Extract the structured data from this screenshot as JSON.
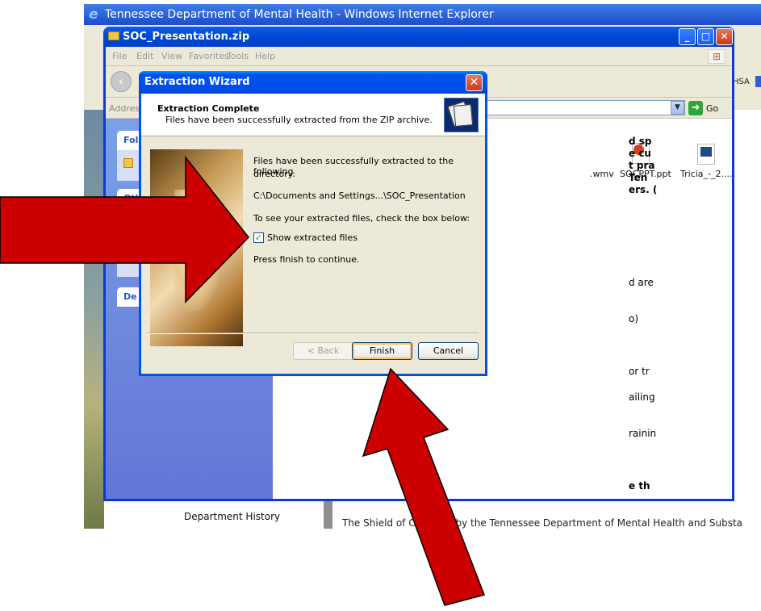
{
  "ie_window": {
    "title": "Tennessee Department of Mental Health - Windows Internet Explorer",
    "hsa_text": "HSA",
    "department_history_link": "Department History",
    "shield_text": "The Shield of Ca          ghted by the Tennessee Department of Mental Health and Substa"
  },
  "zip_window": {
    "title": "SOC_Presentation.zip",
    "menu": [
      "File",
      "Edit",
      "View",
      "Favorites",
      "Tools",
      "Help"
    ],
    "address_label": "Address",
    "go_label": "Go",
    "tasks": {
      "folder_head": "Fol",
      "other_head": "Oth",
      "details_head": "De"
    },
    "files": [
      {
        "name": ".wmv",
        "icon": "video-file-icon"
      },
      {
        "name": "SOCPPT.ppt",
        "icon": "powerpoint-file-icon"
      },
      {
        "name": "Tricia_-_2....",
        "icon": "wmv-file-icon"
      }
    ],
    "right_cut_text": [
      "d sp",
      "e cu",
      "t pra",
      "Ten",
      "ers. (",
      "d are",
      "o)",
      "or tr",
      "ailing",
      "rainin",
      "e th"
    ]
  },
  "wizard": {
    "title": "Extraction Wizard",
    "heading": "Extraction Complete",
    "subheading": "Files have been successfully extracted from the ZIP archive.",
    "message_line1": "Files have been successfully extracted to the following",
    "message_line2": "directory:",
    "path": "C:\\Documents and Settings...\\SOC_Presentation",
    "check_instruction": "To see your extracted files, check the box below:",
    "checkbox_label": "Show extracted files",
    "checkbox_checked": true,
    "continue_text": "Press finish to continue.",
    "buttons": {
      "back": "< Back",
      "finish": "Finish",
      "cancel": "Cancel"
    }
  },
  "colors": {
    "arrow": "#cc0000",
    "xp_blue": "#0054e3",
    "dialog_bg": "#ece9d8"
  }
}
